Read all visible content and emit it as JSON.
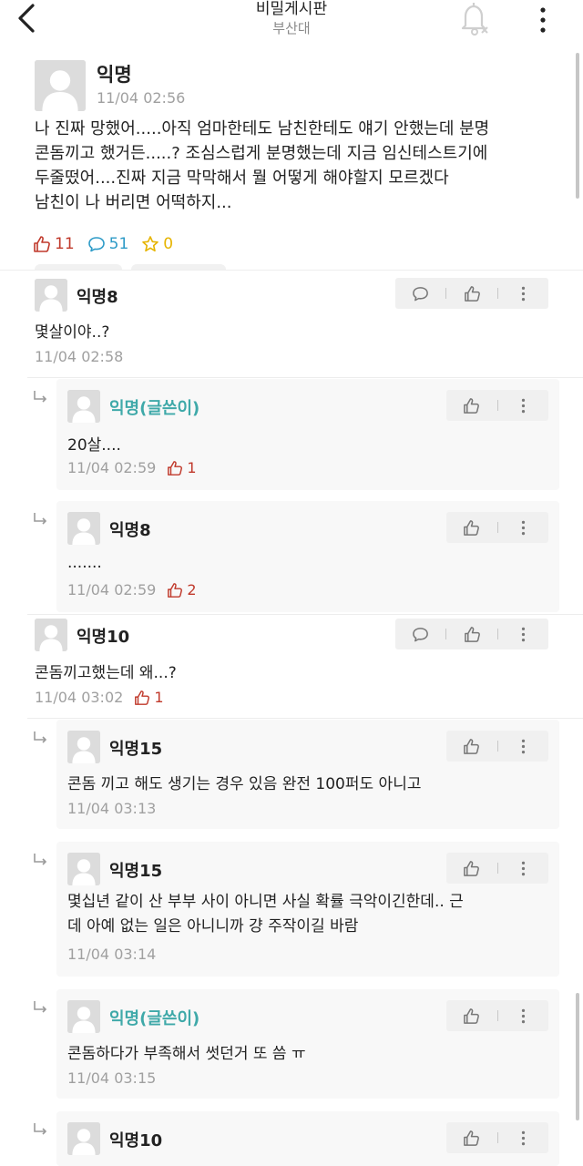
{
  "header": {
    "title": "비밀게시판",
    "subtitle": "부산대"
  },
  "post": {
    "author": "익명",
    "time": "11/04 02:56",
    "body": "나 진짜 망했어.....아직 엄마한테도 남친한테도 얘기 안했는데 분명\n콘돔끼고 했거든.....? 조심스럽게 분명했는데 지금 임신테스트기에\n두줄떴어....진짜 지금 막막해서 뭘 어떻게 해야할지 모르겠다\n남친이 나 버리면 어떡하지...",
    "likes": "11",
    "comments": "51",
    "scraps": "0"
  },
  "comments": [
    {
      "author": "익명8",
      "body": "몇살이야..?",
      "time": "11/04 02:58",
      "votes": ""
    },
    {
      "author": "익명(글쓴이)",
      "body": "20살....",
      "time": "11/04 02:59",
      "votes": "1"
    },
    {
      "author": "익명8",
      "body": ".......",
      "time": "11/04 02:59",
      "votes": "2"
    },
    {
      "author": "익명10",
      "body": "콘돔끼고했는데 왜...?",
      "time": "11/04 03:02",
      "votes": "1"
    },
    {
      "author": "익명15",
      "body": "콘돔 끼고 해도 생기는 경우 있음 완전 100퍼도 아니고",
      "time": "11/04 03:13",
      "votes": ""
    },
    {
      "author": "익명15",
      "body": "몇십년 같이 산 부부 사이 아니면 사실 확률 극악이긴한데.. 근\n데 아예 없는 일은 아니니까 걍 주작이길 바람",
      "time": "11/04 03:14",
      "votes": ""
    },
    {
      "author": "익명(글쓴이)",
      "body": "콘돔하다가 부족해서 썻던거 또 씀 ㅠ",
      "time": "11/04 03:15",
      "votes": ""
    },
    {
      "author": "익명10",
      "body": "",
      "time": "",
      "votes": ""
    }
  ]
}
